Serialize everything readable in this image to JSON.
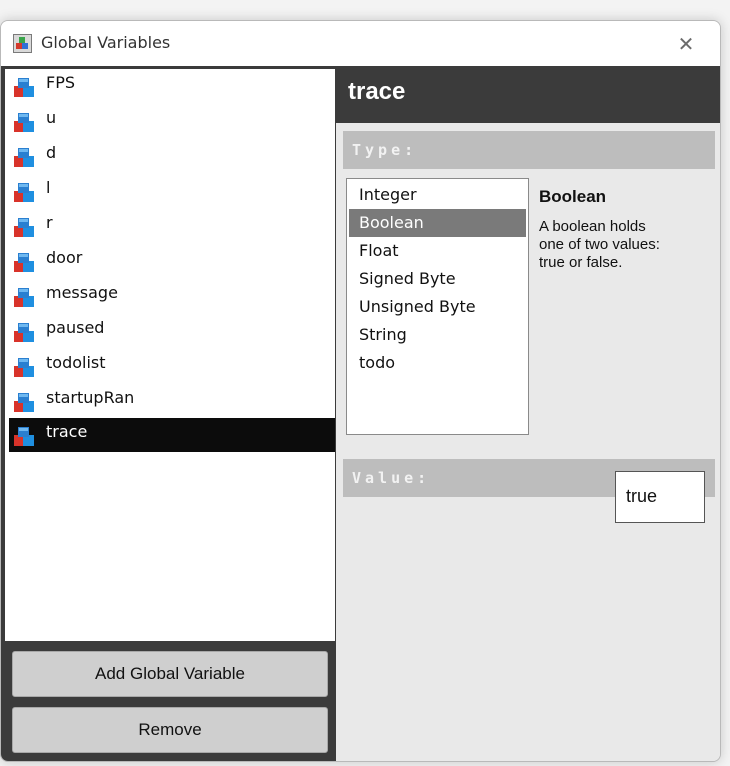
{
  "window": {
    "title": "Global Variables",
    "close_glyph": "✕",
    "app_icon": "game-maker-icon"
  },
  "variables": {
    "icon": "variable-cube-icon",
    "items": [
      {
        "label": "FPS"
      },
      {
        "label": "u"
      },
      {
        "label": "d"
      },
      {
        "label": "l"
      },
      {
        "label": "r"
      },
      {
        "label": "door"
      },
      {
        "label": "message"
      },
      {
        "label": "paused"
      },
      {
        "label": "todolist"
      },
      {
        "label": "startupRan"
      },
      {
        "label": "trace"
      }
    ],
    "selected": "trace"
  },
  "buttons": {
    "add_label": "Add Global Variable",
    "remove_label": "Remove"
  },
  "detail": {
    "name": "trace",
    "type_section_label": "Type:",
    "value_section_label": "Value:",
    "types": [
      "Integer",
      "Boolean",
      "Float",
      "Signed Byte",
      "Unsigned Byte",
      "String",
      "todo"
    ],
    "selected_type": "Boolean",
    "description_title": "Boolean",
    "description_lines": [
      "A boolean holds",
      "one of two values:",
      "true or false."
    ],
    "value": "true"
  },
  "colors": {
    "panel_dark": "#3b3b3b",
    "selected_row": "#0c0c0c",
    "section_bar": "#bdbdbd"
  }
}
